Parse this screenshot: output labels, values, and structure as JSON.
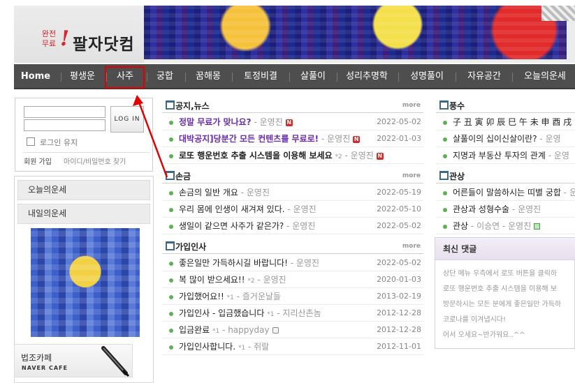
{
  "logo": {
    "small_line1": "완전",
    "small_line2": "무료",
    "bang": "!",
    "main": "팔자닷컴"
  },
  "nav": {
    "items": [
      "Home",
      "평생운",
      "사주",
      "궁합",
      "꿈해몽",
      "토정비결",
      "살풀이",
      "성리추명학",
      "성명풀이",
      "자유공간",
      "오늘의운세"
    ],
    "highlighted": "사주"
  },
  "login": {
    "button": "LOG IN",
    "keep": "로그인 유지",
    "join": "회원 가입",
    "find": "아이디/비밀번호 찾기"
  },
  "left_menu": {
    "items": [
      "오늘의운세",
      "내일의운세"
    ]
  },
  "cafe": {
    "title": "법조카페",
    "subtitle": "NAVER CAFE"
  },
  "boards": {
    "notice": {
      "title": "공지,뉴스",
      "more": "more",
      "rows": [
        {
          "title": "정말 무료가 맞나요?",
          "author": "운영진",
          "date": "2022-05-02"
        },
        {
          "title": "대박공지]당분간 모든 컨텐츠를 무료로!",
          "author": "운영진",
          "date": "2022-01-03"
        },
        {
          "title": "로또 행운번호 추출 시스템을 이용해 보세요",
          "count": "2",
          "author": "운영진",
          "badge": "N"
        }
      ]
    },
    "sonkeum": {
      "title": "손금",
      "more": "more",
      "rows": [
        {
          "title": "손금의 일반 개요",
          "author": "운영진",
          "date": "2022-05-19"
        },
        {
          "title": "우리 몸에 인생이 새겨져 있다.",
          "author": "운영진",
          "date": "2022-05-10"
        },
        {
          "title": "생일이 같으면 사주가 같은가?",
          "author": "운영진",
          "date": "2022-05-02"
        }
      ]
    },
    "greet": {
      "title": "가입인사",
      "more": "more",
      "rows": [
        {
          "title": "좋은일만 가득하시길 바랍니다!",
          "author": "운영진",
          "date": "2022-05-02"
        },
        {
          "title": "복 많이 받으세요!!",
          "count": "2",
          "author": "운영진",
          "date": "2020-01-03"
        },
        {
          "title": "가입했어요!!",
          "count": "1",
          "author": "즐거운날들",
          "date": "2013-02-19"
        },
        {
          "title": "가입인사 - 입금했습니다",
          "count": "1",
          "author": "지리산촌놈",
          "date": "2012-12-28"
        },
        {
          "title": "입금완료",
          "count": "1",
          "author": "happyday",
          "date": "2012-12-28"
        },
        {
          "title": "가입인사합니다.",
          "count": "1",
          "author": "쥐랄",
          "date": "2012-11-01"
        }
      ]
    },
    "fengshui": {
      "title": "풍수",
      "rows": [
        {
          "title": "子 丑 寅 卯 辰 巳 午 未 申 酉 戌"
        },
        {
          "title": "살풀이의 십이신살이란?",
          "author": "운영"
        },
        {
          "title": "지명과 부동산 투자의 관계",
          "author": "운영"
        }
      ]
    },
    "face": {
      "title": "관상",
      "rows": [
        {
          "title": "어른들이 말씀하시는 띠별 궁합",
          "author": "운"
        },
        {
          "title": "관상과 성형수술",
          "author": "운영진"
        },
        {
          "title": "관상",
          "author": "이승연 - 운영진"
        }
      ]
    }
  },
  "comments": {
    "title": "최신 댓글",
    "items": [
      "상단 메뉴 우측에서 로또 버튼을 클릭하",
      "로또 행운번호 추출 시스템을 이용해 보",
      "방문하시는 모든 분에게 좋은일만 가득하",
      "코로나를 이겨냅시다!",
      "어서 오세요~반가워요..^^"
    ]
  },
  "colors": {
    "nav_bg": "#4e4e4e",
    "highlight": "#e10000",
    "title_purple": "#6a2bb0",
    "bullet": "#5db053",
    "badge_red": "#d42a2a"
  }
}
